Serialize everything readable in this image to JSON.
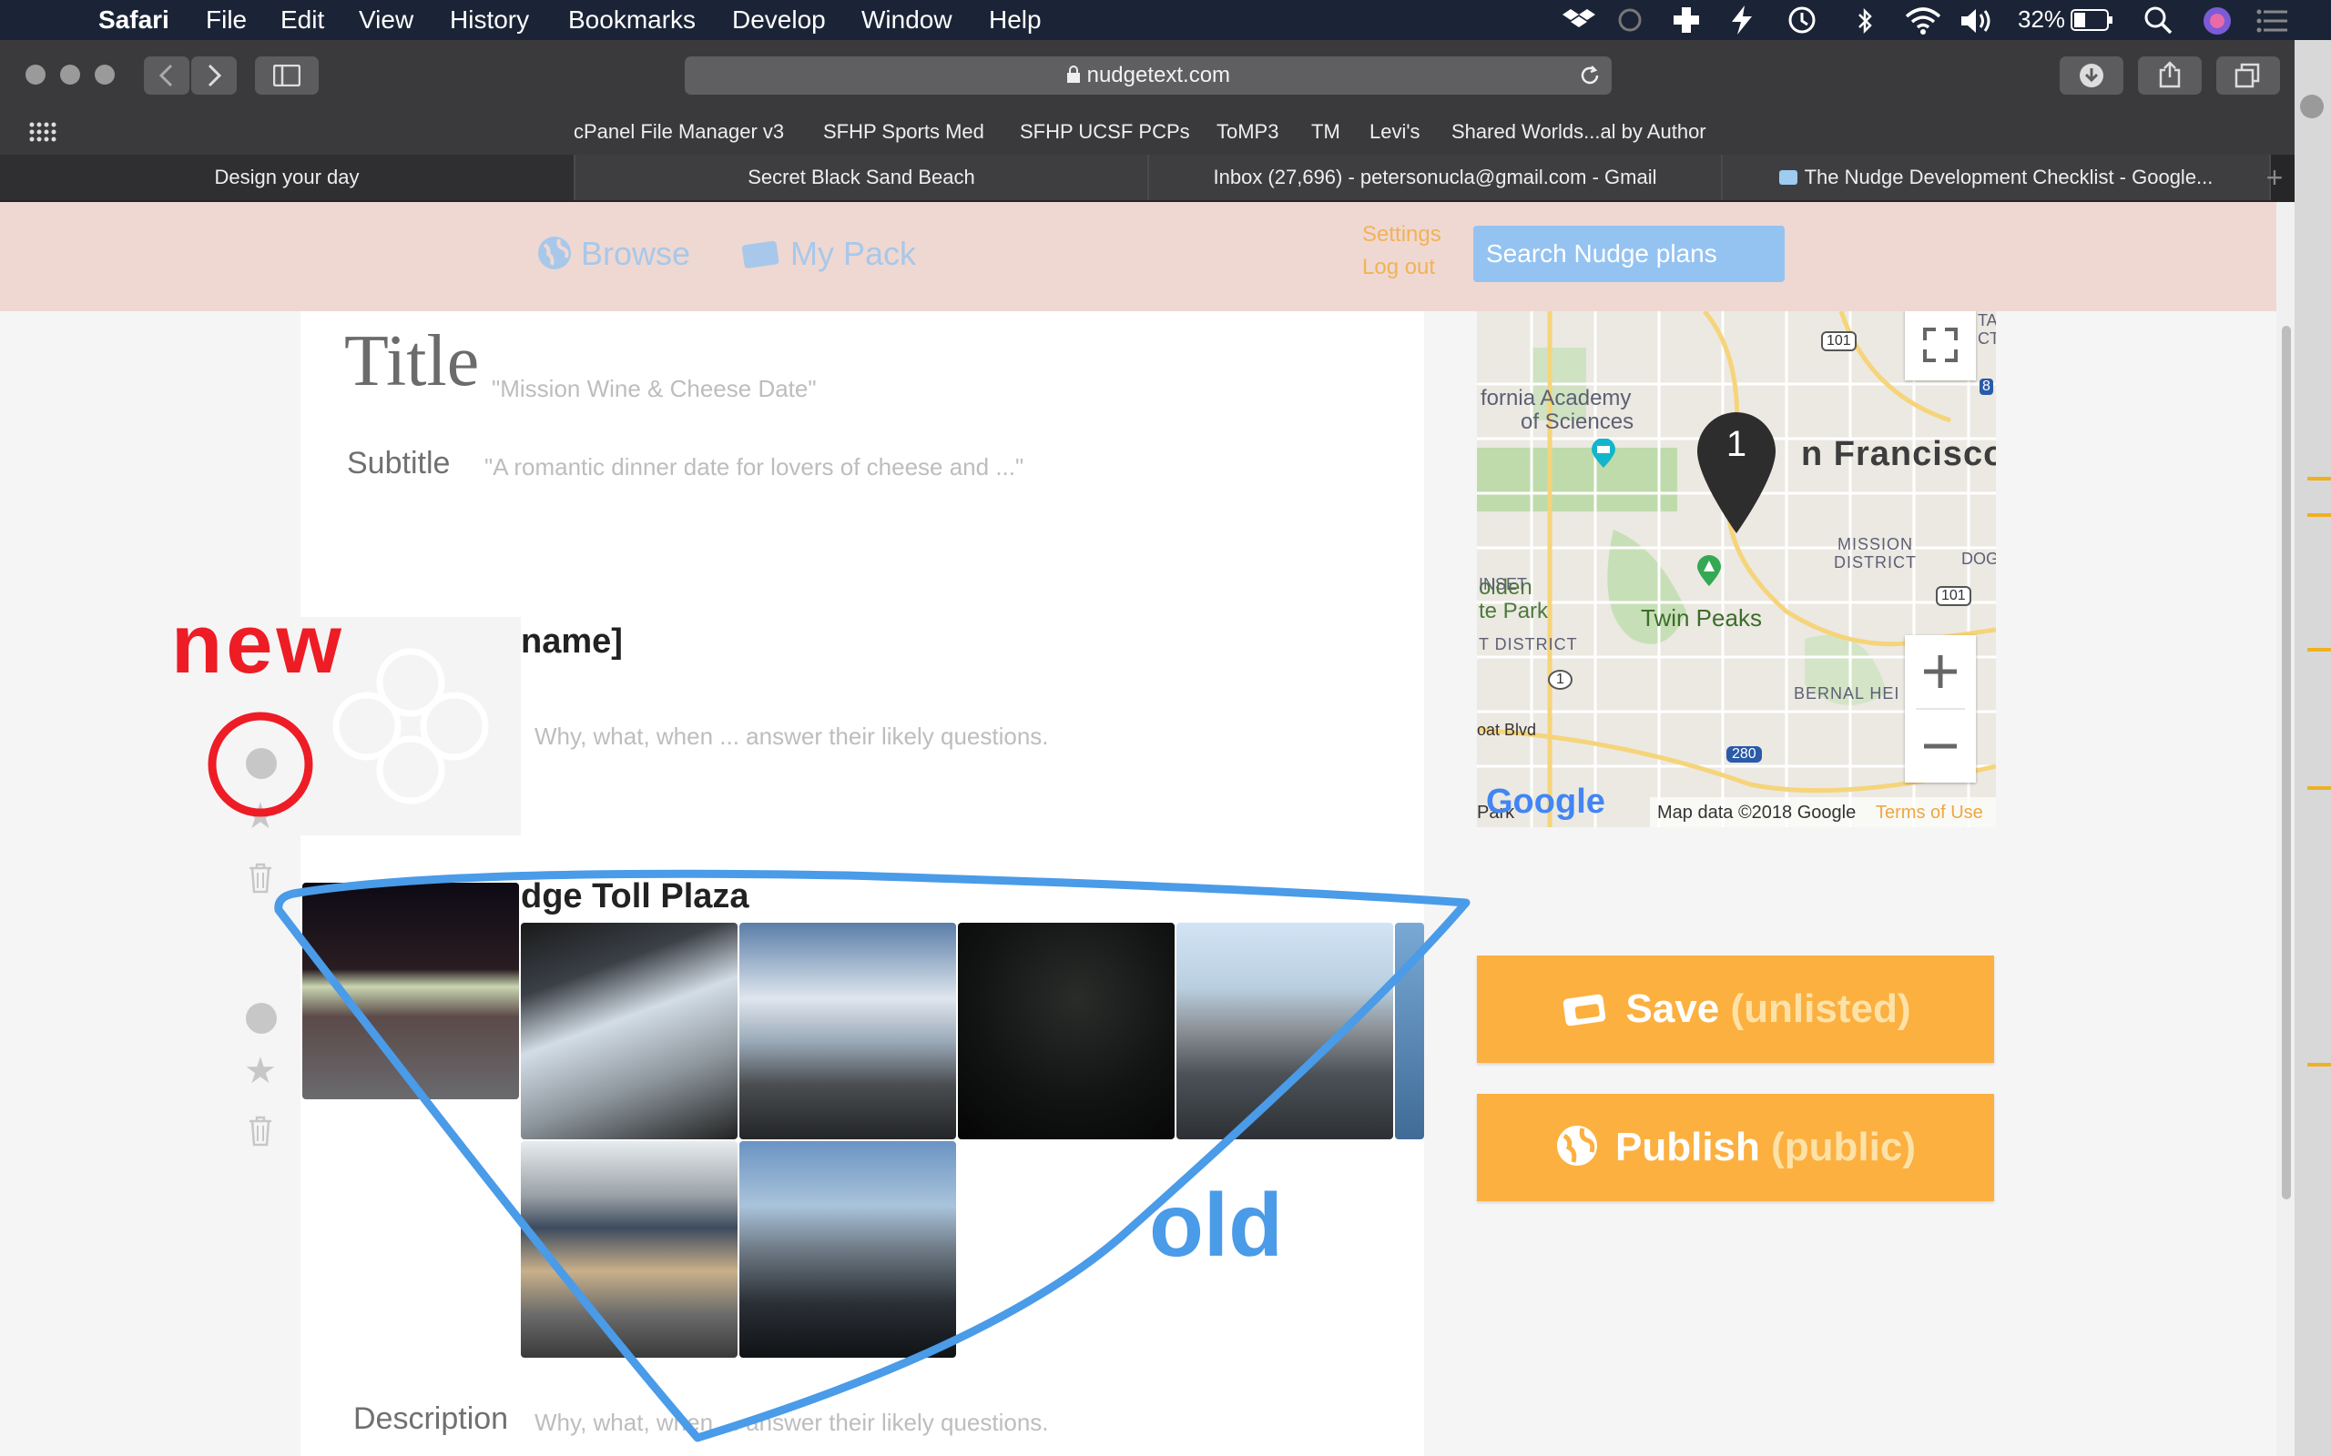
{
  "menubar": {
    "app": "Safari",
    "items": [
      "File",
      "Edit",
      "View",
      "History",
      "Bookmarks",
      "Develop",
      "Window",
      "Help"
    ],
    "battery": "32%"
  },
  "browser": {
    "url": "nudgetext.com",
    "bookmarks": [
      "cPanel File Manager v3",
      "SFHP Sports Med",
      "SFHP UCSF PCPs",
      "ToMP3",
      "TM",
      "Levi's",
      "Shared Worlds...al by Author"
    ],
    "tabs": [
      {
        "label": "Design your day",
        "active": false
      },
      {
        "label": "Secret Black Sand Beach",
        "active": true
      },
      {
        "label": "Inbox (27,696) - petersonucla@gmail.com - Gmail",
        "active": true
      },
      {
        "label": "The Nudge Development Checklist - Google...",
        "active": true
      }
    ]
  },
  "app_header": {
    "browse": "Browse",
    "my_pack": "My Pack",
    "settings": "Settings",
    "logout": "Log out",
    "search_placeholder": "Search Nudge plans"
  },
  "editor": {
    "title_label": "Title",
    "title_placeholder": "\"Mission Wine & Cheese Date\"",
    "subtitle_label": "Subtitle",
    "subtitle_placeholder": "\"A romantic dinner date for lovers of cheese and ...\"",
    "step1": {
      "name": "name]",
      "placeholder": "Why, what, when ... answer their likely questions."
    },
    "step2": {
      "name": "dge Toll Plaza"
    },
    "description_label": "Description",
    "description_placeholder": "Why, what, when ... answer their likely questions."
  },
  "map": {
    "labels": {
      "academy": "fornia Academy",
      "academy2": "of Sciences",
      "city": "n Francisco",
      "golden": "olden",
      "golden2": "te Park",
      "mission": "MISSION",
      "district": "DISTRICT",
      "dog": "DOG",
      "sunset": "INSET",
      "twin_peaks": "Twin Peaks",
      "tdistrict": "T DISTRICT",
      "bernal": "BERNAL HEI",
      "boat": "oat Blvd",
      "park": "Park",
      "google": "Google",
      "attribution": "Map data ©2018 Google",
      "terms": "Terms of Use",
      "shield_101": "101",
      "shield_1": "1",
      "shield_280": "280",
      "shield_8": "8",
      "tia": "TA",
      "ct": "CT"
    },
    "marker": "1"
  },
  "actions": {
    "save": "Save",
    "save_sub": "(unlisted)",
    "publish": "Publish",
    "publish_sub": "(public)"
  },
  "annotations": {
    "new": "new",
    "old": "old",
    "new_color": "#ee1c25",
    "old_color": "#4a9be8"
  },
  "colors": {
    "accent_orange": "#fcb040",
    "link_blue": "#a7c8ea",
    "header_pink": "#efd8d2"
  }
}
